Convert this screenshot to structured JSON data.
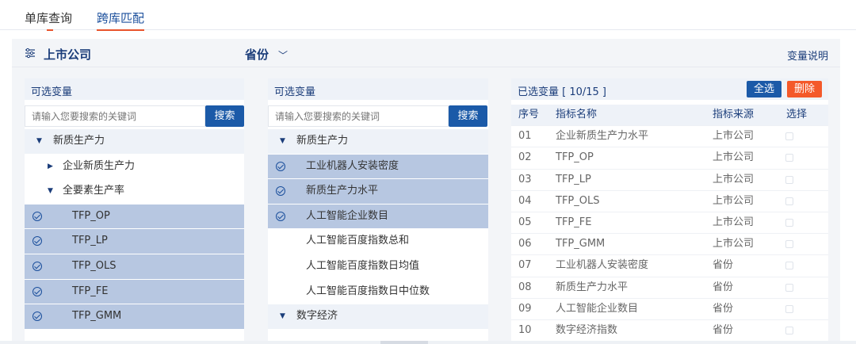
{
  "tabs": {
    "single": "单库查询",
    "cross": "跨库匹配"
  },
  "header": {
    "title": "上市公司",
    "province": "省份",
    "chevron": "﹀",
    "explain": "变量说明"
  },
  "left": {
    "head": "可选变量",
    "search_placeholder": "请输入您要搜索的关键词",
    "search_button": "搜索",
    "nodes": [
      {
        "label": "新质生产力",
        "type": "cat",
        "arrow": "▼"
      },
      {
        "label": "企业新质生产力",
        "type": "sub",
        "arrow": "▶"
      },
      {
        "label": "全要素生产率",
        "type": "sub",
        "arrow": "▼"
      },
      {
        "label": "TFP_OP",
        "type": "sel"
      },
      {
        "label": "TFP_LP",
        "type": "sel"
      },
      {
        "label": "TFP_OLS",
        "type": "sel"
      },
      {
        "label": "TFP_FE",
        "type": "sel"
      },
      {
        "label": "TFP_GMM",
        "type": "sel"
      }
    ]
  },
  "middle": {
    "head": "可选变量",
    "search_placeholder": "请输入您要搜索的关键词",
    "search_button": "搜索",
    "nodes": [
      {
        "label": "新质生产力",
        "type": "cat",
        "arrow": "▼"
      },
      {
        "label": "工业机器人安装密度",
        "type": "sel"
      },
      {
        "label": "新质生产力水平",
        "type": "sel"
      },
      {
        "label": "人工智能企业数目",
        "type": "sel"
      },
      {
        "label": "人工智能百度指数总和",
        "type": "plain"
      },
      {
        "label": "人工智能百度指数日均值",
        "type": "plain"
      },
      {
        "label": "人工智能百度指数日中位数",
        "type": "plain"
      },
      {
        "label": "数字经济",
        "type": "cat",
        "arrow": "▼"
      }
    ]
  },
  "right": {
    "head": "已选变量 [ 10/15 ]",
    "select_all": "全选",
    "delete": "删除",
    "columns": [
      "序号",
      "指标名称",
      "指标来源",
      "选择"
    ],
    "rows": [
      [
        "01",
        "企业新质生产力水平",
        "上市公司"
      ],
      [
        "02",
        "TFP_OP",
        "上市公司"
      ],
      [
        "03",
        "TFP_LP",
        "上市公司"
      ],
      [
        "04",
        "TFP_OLS",
        "上市公司"
      ],
      [
        "05",
        "TFP_FE",
        "上市公司"
      ],
      [
        "06",
        "TFP_GMM",
        "上市公司"
      ],
      [
        "07",
        "工业机器人安装密度",
        "省份"
      ],
      [
        "08",
        "新质生产力水平",
        "省份"
      ],
      [
        "09",
        "人工智能企业数目",
        "省份"
      ],
      [
        "10",
        "数字经济指数",
        "省份"
      ]
    ]
  }
}
